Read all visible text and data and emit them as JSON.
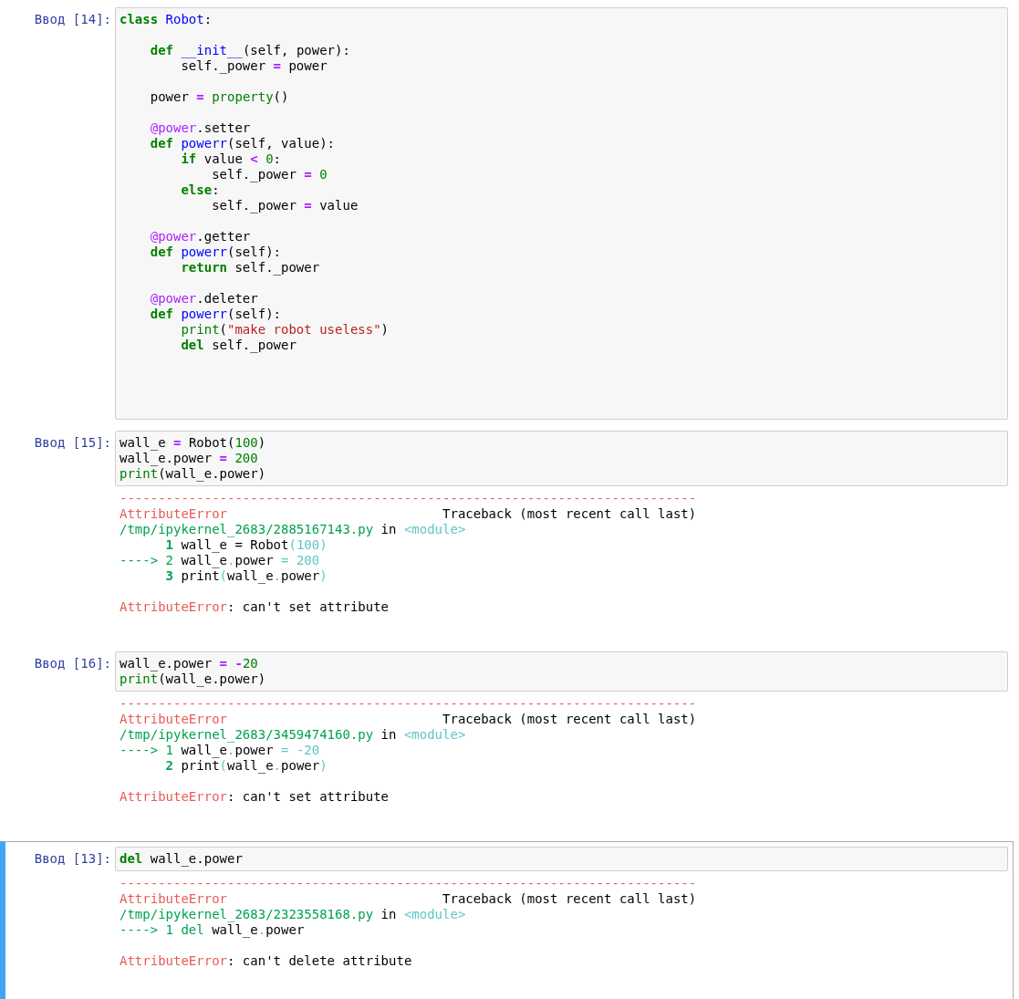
{
  "cells": [
    {
      "prompt": "Ввод [14]:",
      "selected": false,
      "code": [
        {
          "kind": "code",
          "tokens": [
            {
              "kind": "kw",
              "text": "class "
            },
            {
              "kind": "nm",
              "text": "Robot"
            },
            {
              "kind": "p",
              "text": ":"
            }
          ]
        },
        {
          "kind": "blank"
        },
        {
          "kind": "code",
          "tokens": [
            {
              "kind": "kw",
              "text": "    def "
            },
            {
              "kind": "nm",
              "text": "__init__"
            },
            {
              "kind": "p",
              "text": "(self, power):"
            }
          ]
        },
        {
          "kind": "code",
          "tokens": [
            {
              "kind": "p",
              "text": "        self._power "
            },
            {
              "kind": "op",
              "text": "="
            },
            {
              "kind": "p",
              "text": " power"
            }
          ]
        },
        {
          "kind": "blank"
        },
        {
          "kind": "code",
          "tokens": [
            {
              "kind": "p",
              "text": "    power "
            },
            {
              "kind": "op",
              "text": "="
            },
            {
              "kind": "bi",
              "text": " property"
            },
            {
              "kind": "p",
              "text": "()"
            }
          ]
        },
        {
          "kind": "blank"
        },
        {
          "kind": "code",
          "tokens": [
            {
              "kind": "dec",
              "text": "    @power"
            },
            {
              "kind": "p",
              "text": ".setter"
            }
          ]
        },
        {
          "kind": "code",
          "tokens": [
            {
              "kind": "kw",
              "text": "    def "
            },
            {
              "kind": "nm",
              "text": "powerr"
            },
            {
              "kind": "p",
              "text": "(self, value):"
            }
          ]
        },
        {
          "kind": "code",
          "tokens": [
            {
              "kind": "kw",
              "text": "        if"
            },
            {
              "kind": "p",
              "text": " value "
            },
            {
              "kind": "op",
              "text": "<"
            },
            {
              "kind": "num",
              "text": " 0"
            },
            {
              "kind": "p",
              "text": ":"
            }
          ]
        },
        {
          "kind": "code",
          "tokens": [
            {
              "kind": "p",
              "text": "            self._power "
            },
            {
              "kind": "op",
              "text": "="
            },
            {
              "kind": "num",
              "text": " 0"
            }
          ]
        },
        {
          "kind": "code",
          "tokens": [
            {
              "kind": "kw",
              "text": "        else"
            },
            {
              "kind": "p",
              "text": ":"
            }
          ]
        },
        {
          "kind": "code",
          "tokens": [
            {
              "kind": "p",
              "text": "            self._power "
            },
            {
              "kind": "op",
              "text": "="
            },
            {
              "kind": "p",
              "text": " value"
            }
          ]
        },
        {
          "kind": "blank"
        },
        {
          "kind": "code",
          "tokens": [
            {
              "kind": "dec",
              "text": "    @power"
            },
            {
              "kind": "p",
              "text": ".getter"
            }
          ]
        },
        {
          "kind": "code",
          "tokens": [
            {
              "kind": "kw",
              "text": "    def "
            },
            {
              "kind": "nm",
              "text": "powerr"
            },
            {
              "kind": "p",
              "text": "(self):"
            }
          ]
        },
        {
          "kind": "code",
          "tokens": [
            {
              "kind": "kw",
              "text": "        return"
            },
            {
              "kind": "p",
              "text": " self._power"
            }
          ]
        },
        {
          "kind": "blank"
        },
        {
          "kind": "code",
          "tokens": [
            {
              "kind": "dec",
              "text": "    @power"
            },
            {
              "kind": "p",
              "text": ".deleter"
            }
          ]
        },
        {
          "kind": "code",
          "tokens": [
            {
              "kind": "kw",
              "text": "    def "
            },
            {
              "kind": "nm",
              "text": "powerr"
            },
            {
              "kind": "p",
              "text": "(self):"
            }
          ]
        },
        {
          "kind": "code",
          "tokens": [
            {
              "kind": "bi",
              "text": "        print"
            },
            {
              "kind": "p",
              "text": "("
            },
            {
              "kind": "str",
              "text": "\"make robot useless\""
            },
            {
              "kind": "p",
              "text": ")"
            }
          ]
        },
        {
          "kind": "code",
          "tokens": [
            {
              "kind": "kw",
              "text": "        del"
            },
            {
              "kind": "p",
              "text": " self._power"
            }
          ]
        },
        {
          "kind": "blank"
        },
        {
          "kind": "blank"
        },
        {
          "kind": "blank"
        },
        {
          "kind": "blank"
        }
      ]
    },
    {
      "prompt": "Ввод [15]:",
      "selected": false,
      "code": [
        {
          "kind": "code",
          "tokens": [
            {
              "kind": "p",
              "text": "wall_e "
            },
            {
              "kind": "op",
              "text": "="
            },
            {
              "kind": "p",
              "text": " Robot("
            },
            {
              "kind": "num",
              "text": "100"
            },
            {
              "kind": "p",
              "text": ")"
            }
          ]
        },
        {
          "kind": "code",
          "tokens": [
            {
              "kind": "p",
              "text": "wall_e.power "
            },
            {
              "kind": "op",
              "text": "="
            },
            {
              "kind": "num",
              "text": " 200"
            }
          ]
        },
        {
          "kind": "code",
          "tokens": [
            {
              "kind": "bi",
              "text": "print"
            },
            {
              "kind": "p",
              "text": "(wall_e.power)"
            }
          ]
        }
      ],
      "output": [
        {
          "kind": "code",
          "tokens": [
            {
              "kind": "er",
              "text": "---------------------------------------------------------------------------"
            }
          ]
        },
        {
          "kind": "code",
          "tokens": [
            {
              "kind": "er",
              "text": "AttributeError"
            },
            {
              "kind": "p",
              "text": "                            Traceback (most recent call last)"
            }
          ]
        },
        {
          "kind": "code",
          "tokens": [
            {
              "kind": "gr",
              "text": "/tmp/ipykernel_2683/2885167143.py"
            },
            {
              "kind": "p",
              "text": " in "
            },
            {
              "kind": "cy",
              "text": "<module>"
            }
          ]
        },
        {
          "kind": "code",
          "tokens": [
            {
              "kind": "gb",
              "text": "      1"
            },
            {
              "kind": "p",
              "text": " wall_e = Robot"
            },
            {
              "kind": "cy",
              "text": "(100)"
            }
          ]
        },
        {
          "kind": "code",
          "tokens": [
            {
              "kind": "gr",
              "text": "----> 2"
            },
            {
              "kind": "p",
              "text": " wall_e"
            },
            {
              "kind": "cy",
              "text": "."
            },
            {
              "kind": "p",
              "text": "power "
            },
            {
              "kind": "cy",
              "text": "= 200"
            }
          ]
        },
        {
          "kind": "code",
          "tokens": [
            {
              "kind": "gb",
              "text": "      3"
            },
            {
              "kind": "p",
              "text": " print"
            },
            {
              "kind": "cy",
              "text": "("
            },
            {
              "kind": "p",
              "text": "wall_e"
            },
            {
              "kind": "cy",
              "text": "."
            },
            {
              "kind": "p",
              "text": "power"
            },
            {
              "kind": "cy",
              "text": ")"
            }
          ]
        },
        {
          "kind": "blank"
        },
        {
          "kind": "code",
          "tokens": [
            {
              "kind": "er",
              "text": "AttributeError"
            },
            {
              "kind": "p",
              "text": ": can't set attribute"
            }
          ]
        }
      ]
    },
    {
      "prompt": "Ввод [16]:",
      "selected": false,
      "code": [
        {
          "kind": "code",
          "tokens": [
            {
              "kind": "p",
              "text": "wall_e.power "
            },
            {
              "kind": "op",
              "text": "="
            },
            {
              "kind": "op",
              "text": " -"
            },
            {
              "kind": "num",
              "text": "20"
            }
          ]
        },
        {
          "kind": "code",
          "tokens": [
            {
              "kind": "bi",
              "text": "print"
            },
            {
              "kind": "p",
              "text": "(wall_e.power)"
            }
          ]
        }
      ],
      "output": [
        {
          "kind": "code",
          "tokens": [
            {
              "kind": "er",
              "text": "---------------------------------------------------------------------------"
            }
          ]
        },
        {
          "kind": "code",
          "tokens": [
            {
              "kind": "er",
              "text": "AttributeError"
            },
            {
              "kind": "p",
              "text": "                            Traceback (most recent call last)"
            }
          ]
        },
        {
          "kind": "code",
          "tokens": [
            {
              "kind": "gr",
              "text": "/tmp/ipykernel_2683/3459474160.py"
            },
            {
              "kind": "p",
              "text": " in "
            },
            {
              "kind": "cy",
              "text": "<module>"
            }
          ]
        },
        {
          "kind": "code",
          "tokens": [
            {
              "kind": "gr",
              "text": "----> 1"
            },
            {
              "kind": "p",
              "text": " wall_e"
            },
            {
              "kind": "cy",
              "text": "."
            },
            {
              "kind": "p",
              "text": "power "
            },
            {
              "kind": "cy",
              "text": "= -20"
            }
          ]
        },
        {
          "kind": "code",
          "tokens": [
            {
              "kind": "gb",
              "text": "      2"
            },
            {
              "kind": "p",
              "text": " print"
            },
            {
              "kind": "cy",
              "text": "("
            },
            {
              "kind": "p",
              "text": "wall_e"
            },
            {
              "kind": "cy",
              "text": "."
            },
            {
              "kind": "p",
              "text": "power"
            },
            {
              "kind": "cy",
              "text": ")"
            }
          ]
        },
        {
          "kind": "blank"
        },
        {
          "kind": "code",
          "tokens": [
            {
              "kind": "er",
              "text": "AttributeError"
            },
            {
              "kind": "p",
              "text": ": can't set attribute"
            }
          ]
        }
      ]
    },
    {
      "prompt": "Ввод [13]:",
      "selected": true,
      "code": [
        {
          "kind": "code",
          "tokens": [
            {
              "kind": "kw",
              "text": "del"
            },
            {
              "kind": "p",
              "text": " wall_e.power"
            }
          ]
        }
      ],
      "output": [
        {
          "kind": "code",
          "tokens": [
            {
              "kind": "er",
              "text": "---------------------------------------------------------------------------"
            }
          ]
        },
        {
          "kind": "code",
          "tokens": [
            {
              "kind": "er",
              "text": "AttributeError"
            },
            {
              "kind": "p",
              "text": "                            Traceback (most recent call last)"
            }
          ]
        },
        {
          "kind": "code",
          "tokens": [
            {
              "kind": "gr",
              "text": "/tmp/ipykernel_2683/2323558168.py"
            },
            {
              "kind": "p",
              "text": " in "
            },
            {
              "kind": "cy",
              "text": "<module>"
            }
          ]
        },
        {
          "kind": "code",
          "tokens": [
            {
              "kind": "gr",
              "text": "----> 1 del"
            },
            {
              "kind": "p",
              "text": " wall_e"
            },
            {
              "kind": "cy",
              "text": "."
            },
            {
              "kind": "p",
              "text": "power"
            }
          ]
        },
        {
          "kind": "blank"
        },
        {
          "kind": "code",
          "tokens": [
            {
              "kind": "er",
              "text": "AttributeError"
            },
            {
              "kind": "p",
              "text": ": can't delete attribute"
            }
          ]
        }
      ]
    }
  ]
}
